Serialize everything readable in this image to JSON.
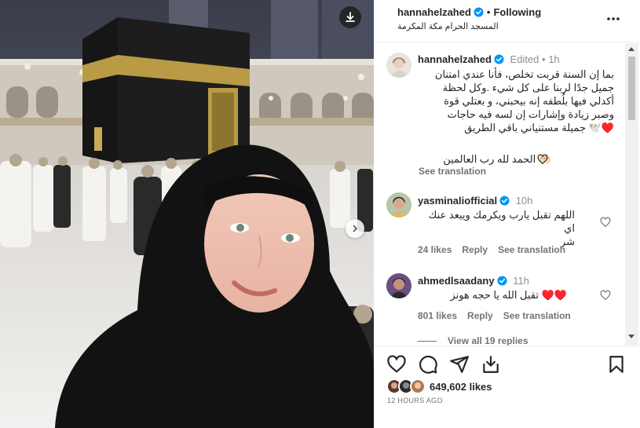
{
  "header": {
    "username": "hannahelzahed",
    "follow_state": "Following",
    "location": "المسجد الحرام مكة المكرمة"
  },
  "caption": {
    "username": "hannahelzahed",
    "edited": "Edited",
    "time": "1h",
    "lines": [
      "بما إن السنة قربت تخلص، فأنا عندي امتنان",
      "جميل جدًا لربنا على كل شيء .وكل لحظة",
      "أكدلي فيها بلُطفه إنه بيحبني، و بعتلي قوة",
      "وصبر زيادة وإشارات إن لسه فيه حاجات",
      "♥️🕊️ جميلة مستنياني باقي الطريق"
    ],
    "closing": "🤲🏻 الحمد لله رب العالمين",
    "see_translation": "See translation"
  },
  "comments": [
    {
      "username": "yasminalio fficial",
      "display_username": "yasminaliofficial",
      "time": "10h",
      "lines": [
        "اللهم تقبل يارب ويكرمك ويبعد عنك اي",
        "شر"
      ],
      "likes": "24 likes",
      "reply": "Reply",
      "see_translation": "See translation"
    },
    {
      "username": "ahmedlsaadany",
      "time": "11h",
      "lines": [
        "♥️♥️ تقبل الله يا حجه هونز"
      ],
      "likes": "801 likes",
      "reply": "Reply",
      "see_translation": "See translation",
      "view_replies": "View all 19 replies"
    }
  ],
  "footer": {
    "likes": "649,602 likes",
    "time_ago": "12 HOURS AGO"
  },
  "icons": {
    "download": "download-icon",
    "next": "chevron-right-icon",
    "more": "more-horizontal-icon",
    "like": "heart-icon",
    "comment": "comment-icon",
    "share": "send-icon",
    "save": "bookmark-icon",
    "verified": "verified-badge-icon"
  },
  "colors": {
    "verified": "#0095f6",
    "red_heart": "#e0245e",
    "muted": "#737373",
    "text": "#262626"
  }
}
